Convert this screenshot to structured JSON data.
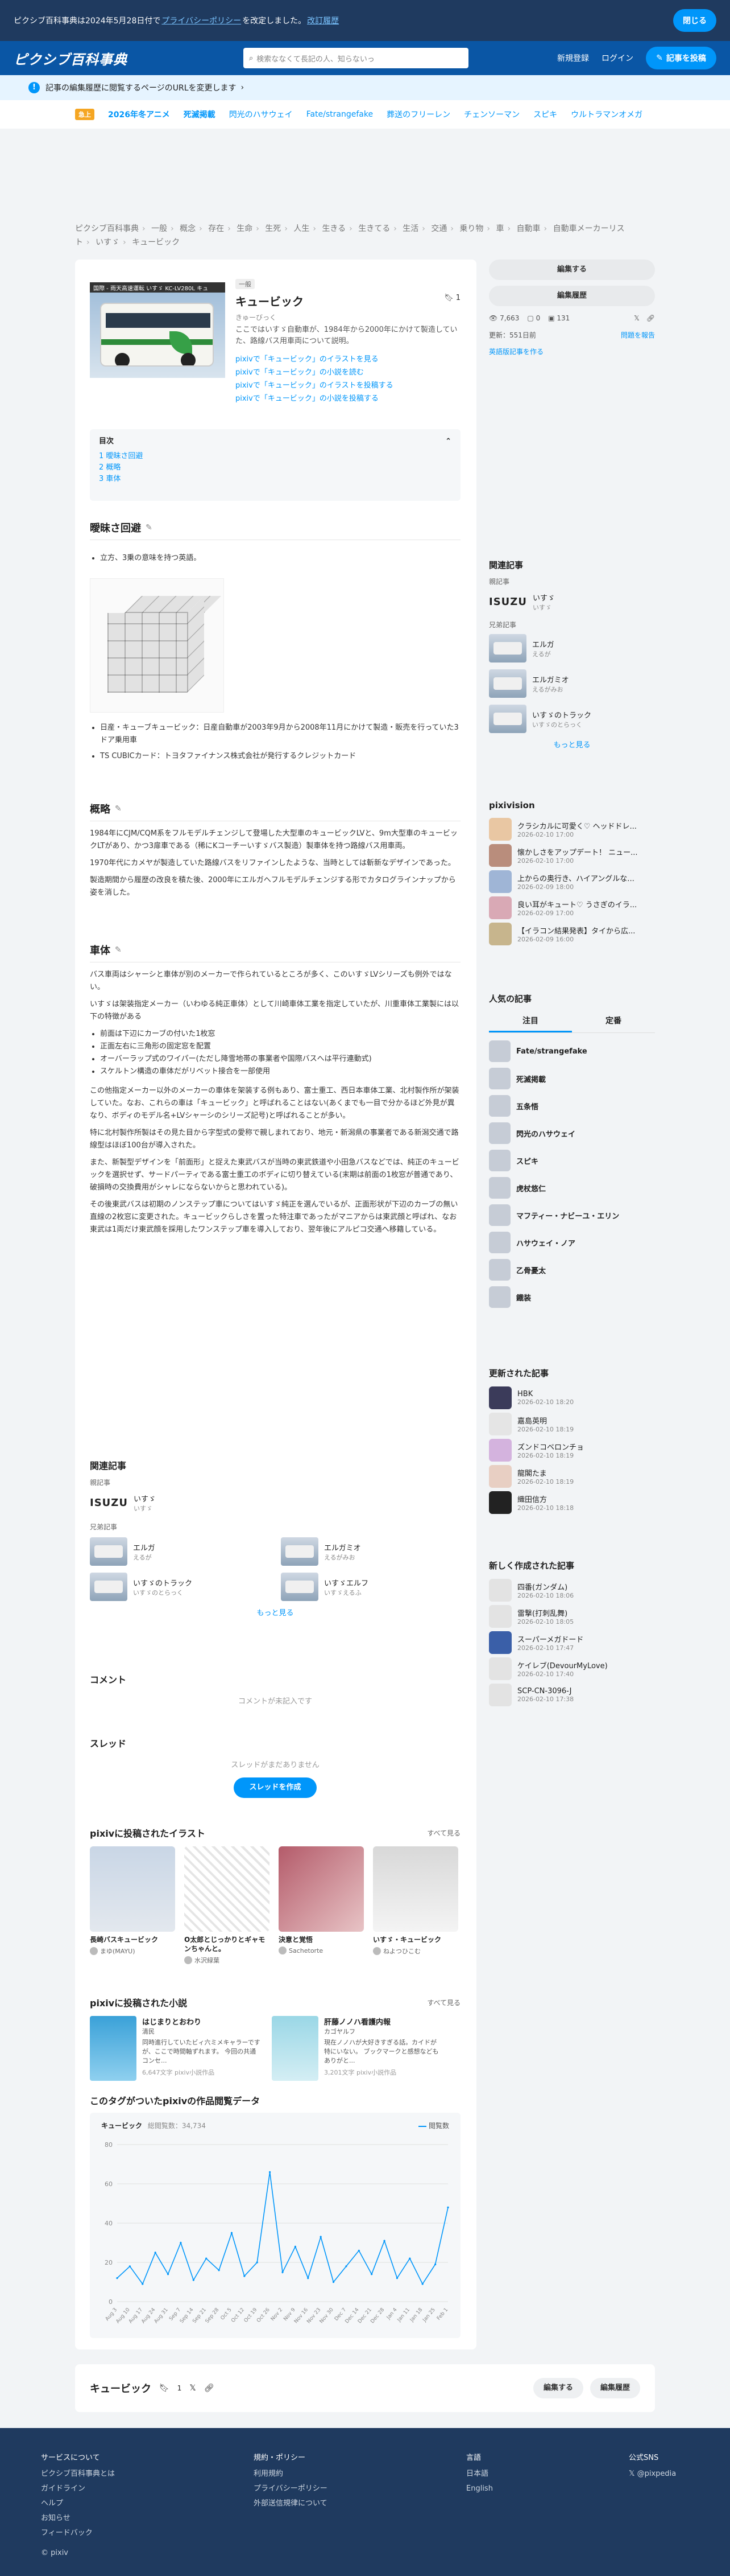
{
  "policy": {
    "text": "ピクシブ百科事典は2024年5月28日付で",
    "link": "プライバシーポリシー",
    "text2": "を改定しました。",
    "link2": "改訂履歴",
    "ok": "閉じる"
  },
  "header": {
    "logo": "ピクシブ百科事典",
    "search_placeholder": "検索ななくて長記の人、知らないっ",
    "signup": "新規登録",
    "login": "ログイン",
    "post": "記事を投稿"
  },
  "notice": {
    "text": "記事の編集履歴に閲覧するページのURLを変更します",
    "arrow": "›"
  },
  "trend": {
    "tag": "急上",
    "items": [
      "2026年冬アニメ",
      "死滅掲載",
      "閃光のハサウェイ",
      "Fate/strangefake",
      "葬送のフリーレン",
      "チェンソーマン",
      "スピキ",
      "ウルトラマンオメガ"
    ]
  },
  "breadcrumb": [
    "ピクシブ百科事典",
    "一般",
    "概念",
    "存在",
    "生命",
    "生死",
    "人生",
    "生きる",
    "生きてる",
    "生活",
    "交通",
    "乗り物",
    "車",
    "自動車",
    "自動車メーカーリスト",
    "いすゞ",
    "キュービック"
  ],
  "article": {
    "badge": "一般",
    "title": "キュービック",
    "reading": "きゅーびっく",
    "bookmark_count": "1",
    "summary": "ここではいすゞ自動車が、1984年から2000年にかけて製造していた、路線バス用車両について説明。",
    "hero_caption": "国際 - 雨天高速運転 いすゞ KC-LV280L キュ",
    "pixiv_links": [
      "pixivで「キュービック」のイラストを見る",
      "pixivで「キュービック」の小説を読む",
      "pixivで「キュービック」のイラストを投稿する",
      "pixivで「キュービック」の小説を投稿する"
    ],
    "toc": {
      "title": "目次",
      "items": [
        "1 曖昧さ回避",
        "2 概略",
        "3 車体"
      ]
    },
    "sections": {
      "s1": {
        "title": "曖昧さ回避",
        "item1": "立方、3乗の意味を持つ英語。",
        "item2": "日産・キューブキュービック：日産自動車が2003年9月から2008年11月にかけて製造・販売を行っていた3ドア乗用車",
        "item3": "TS CUBICカード：トヨタファイナンス株式会社が発行するクレジットカード"
      },
      "s2": {
        "title": "概略",
        "p1": "1984年にCJM/CQM系をフルモデルチェンジして登場した大型車のキュービックLVと、9m大型車のキュービックLTがあり、かつ3扉車である（稀にKコーチーいすゞバス製造）製車体を持つ路線バス用車両。",
        "p2": "1970年代にカメヤが製造していた路線バスをリファインしたような、当時としては斬新なデザインであった。",
        "p3": "製造期間から履歴の改良を積た後、2000年にエルガへフルモデルチェンジする形でカタログラインナップから姿を消した。"
      },
      "s3": {
        "title": "車体",
        "p1": "バス車両はシャーシと車体が別のメーカーで作られているところが多く、このいすゞLVシリーズも例外ではない。",
        "p2": "いすゞは架装指定メーカー（いわゆる純正車体）として川崎車体工業を指定していたが、川重車体工業製には以下の特徴がある",
        "li1": "前面は下辺にカーブの付いた1枚窓",
        "li2": "正面左右に三角形の固定窓を配置",
        "li3": "オーバーラップ式のワイパー(ただし降雪地帯の事業者や国際バスへは平行連動式)",
        "li4": "スケルトン構造の車体だがリベット接合を一部使用",
        "p3": "この他指定メーカー以外のメーカーの車体を架装する例もあり、富士重工、西日本車体工業、北村製作所が架装していた。なお、これらの車は「キュービック」と呼ばれることはない(あくまでも一目で分かるほど外見が異なり、ボディのモデル名+LVシャーシのシリーズ記号)と呼ばれることが多い。",
        "p4": "特に北村製作所製はその見た目から字型式の愛称で親しまれており、地元・新潟県の事業者である新潟交通で路線型はほぼ100台が導入された。",
        "p5": "また、新製型デザインを「前面形」と捉えた東武バスが当時の東武鉄道や小田急バスなどでは、純正のキュービックを選択せず、サードパーティである富士重工のボディに切り替えている(末期は前面の1枚窓が普通であり、破損時の交換費用がシャレにならないからと思われている)。",
        "p6": "その後東武バスは初期のノンステップ車についてはいすゞ純正を選んでいるが、正面形状が下辺のカーブの無い直線の2枚窓に変更された。キュービックらしさを置った特注車であったがマニアからは東武顔と呼ばれ、なお東武は1両だけ東武顔を採用したワンステップ車を導入しており、翌年後にアルピコ交通へ移籍している。"
      }
    },
    "related": {
      "title": "関連記事",
      "parent_label": "親記事",
      "parent_name": "いすゞ",
      "parent_sub": "いすゞ",
      "sibling_label": "兄弟記事",
      "siblings": [
        {
          "name": "エルガ",
          "sub": "えるが"
        },
        {
          "name": "エルガミオ",
          "sub": "えるがみお"
        },
        {
          "name": "いすゞのトラック",
          "sub": "いすゞのとらっく"
        },
        {
          "name": "いすゞエルフ",
          "sub": "いすゞえるふ"
        }
      ],
      "more": "もっと見る"
    },
    "comments": {
      "title": "コメント",
      "empty": "コメントが未記入です"
    },
    "thread": {
      "title": "スレッド",
      "empty": "スレッドがまだありません",
      "create": "スレッドを作成"
    },
    "illusts": {
      "title": "pixivに投稿されたイラスト",
      "seeall": "すべて見る",
      "items": [
        {
          "title": "長崎バスキュービック",
          "author": "まゆ(MAYU)"
        },
        {
          "title": "O太郎とじっかりとギャモンちゃんと。",
          "author": "水沢緑葉"
        },
        {
          "title": "決意と覚悟",
          "author": "Sachetorte"
        },
        {
          "title": "いすゞ・キュービック",
          "author": "ねよつひこむ"
        }
      ]
    },
    "novels": {
      "title": "pixivに投稿された小説",
      "seeall": "すべて見る",
      "items": [
        {
          "title": "はじまりとおわり",
          "author": "清民",
          "desc": "同時進行していたビィ六ミメキャラーですが、ここで時間軸ずれます。 今回の共通コンセ...",
          "meta": "6,647文字 pixiv小説作品"
        },
        {
          "title": "肝藤ノノハ看護内報",
          "author": "カゴヤルフ",
          "desc": "現在ノノハが大好きすぎる話。カイドが特にいない。 ブックマークと感想などもありがと...",
          "meta": "3,201文字 pixiv小説作品"
        }
      ]
    },
    "chart": {
      "title": "このタグがついたpixivの作品閲覧データ",
      "series_label": "キュービック",
      "total_label": "総閲覧数：34,734",
      "legend": "閲覧数"
    }
  },
  "chart_data": {
    "type": "line",
    "title": "",
    "xlabel": "",
    "ylabel": "",
    "ylim": [
      0,
      80
    ],
    "yticks": [
      0,
      20,
      40,
      60,
      80
    ],
    "x": [
      "Aug 3",
      "Aug 10",
      "Aug 17",
      "Aug 24",
      "Aug 31",
      "Sep 7",
      "Sep 14",
      "Sep 21",
      "Sep 28",
      "Oct 5",
      "Oct 12",
      "Oct 19",
      "Oct 26",
      "Nov 2",
      "Nov 9",
      "Nov 16",
      "Nov 23",
      "Nov 30",
      "Dec 7",
      "Dec 14",
      "Dec 21",
      "Dec 28",
      "Jan 4",
      "Jan 11",
      "Jan 18",
      "Jan 25",
      "Feb 1"
    ],
    "series": [
      {
        "name": "閲覧数",
        "values": [
          12,
          18,
          9,
          25,
          14,
          30,
          11,
          22,
          16,
          35,
          13,
          20,
          66,
          15,
          28,
          12,
          33,
          10,
          18,
          26,
          14,
          31,
          12,
          22,
          9,
          19,
          48
        ]
      }
    ]
  },
  "sidebar": {
    "edit": "編集する",
    "history": "編集履歴",
    "views": "7,663",
    "comments": "0",
    "likes": "131",
    "updated": "更新：551日前",
    "report": "問題を報告",
    "english": "英語版記事を作る",
    "related_title": "関連記事",
    "parent_label": "親記事",
    "parent_name": "いすゞ",
    "parent_sub": "いすゞ",
    "sibling_label": "兄弟記事",
    "siblings": [
      {
        "name": "エルガ",
        "sub": "えるが"
      },
      {
        "name": "エルガミオ",
        "sub": "えるがみお"
      },
      {
        "name": "いすゞのトラック",
        "sub": "いすゞのとらっく"
      }
    ],
    "more": "もっと見る",
    "pixivision_title": "pixivision",
    "pixivision": [
      {
        "t": "クラシカルに可愛く♡ ヘッドドレ...",
        "d": "2026-02-10 17:00"
      },
      {
        "t": "懐かしさをアップデート！ ニュー...",
        "d": "2026-02-10 17:00"
      },
      {
        "t": "上からの奥行き、ハイアングルな...",
        "d": "2026-02-09 18:00"
      },
      {
        "t": "良い耳がキュート♡ うさぎのイラ...",
        "d": "2026-02-09 17:00"
      },
      {
        "t": "【イラコン結果発表】タイから広...",
        "d": "2026-02-09 16:00"
      }
    ],
    "popular_title": "人気の記事",
    "tab1": "注目",
    "tab2": "定番",
    "popular": [
      "Fate/strangefake",
      "死滅掲載",
      "五条悟",
      "閃光のハサウェイ",
      "スピキ",
      "虎杖悠仁",
      "マフティー・ナビーユ・エリン",
      "ハサウェイ・ノア",
      "乙骨憂太",
      "鐡装"
    ],
    "updated_title": "更新された記事",
    "updated_list": [
      {
        "t": "HBK",
        "d": "2026-02-10 18:20"
      },
      {
        "t": "嘉島英明",
        "d": "2026-02-10 18:19"
      },
      {
        "t": "ズンドコベロンチョ",
        "d": "2026-02-10 18:19"
      },
      {
        "t": "龍閣たま",
        "d": "2026-02-10 18:19"
      },
      {
        "t": "織田信方",
        "d": "2026-02-10 18:18"
      }
    ],
    "new_title": "新しく作成された記事",
    "new_list": [
      {
        "t": "四番(ガンダム)",
        "d": "2026-02-10 18:06"
      },
      {
        "t": "雷撃(打刺乱舞)",
        "d": "2026-02-10 18:05"
      },
      {
        "t": "スーパーメガドード",
        "d": "2026-02-10 17:47"
      },
      {
        "t": "ケイレブ(DevourMyLove)",
        "d": "2026-02-10 17:40"
      },
      {
        "t": "SCP-CN-3096-J",
        "d": "2026-02-10 17:38"
      }
    ]
  },
  "bottombar": {
    "title": "キュービック",
    "count": "1",
    "edit": "編集する",
    "history": "編集履歴"
  },
  "footer": {
    "c1_head": "サービスについて",
    "c1": [
      "ピクシブ百科事典とは",
      "ガイドライン",
      "ヘルプ",
      "お知らせ",
      "フィードバック"
    ],
    "c2_head": "規約・ポリシー",
    "c2": [
      "利用規約",
      "プライバシーポリシー",
      "外部送信規律について"
    ],
    "c3_head": "言語",
    "c3": [
      "日本語",
      "English"
    ],
    "c4_head": "公式SNS",
    "c4": "@pixpedia",
    "copy": "© pixiv"
  },
  "colors": {
    "accent": "#0096fa",
    "header": "#0a56a5",
    "footer": "#1f3a5f"
  }
}
